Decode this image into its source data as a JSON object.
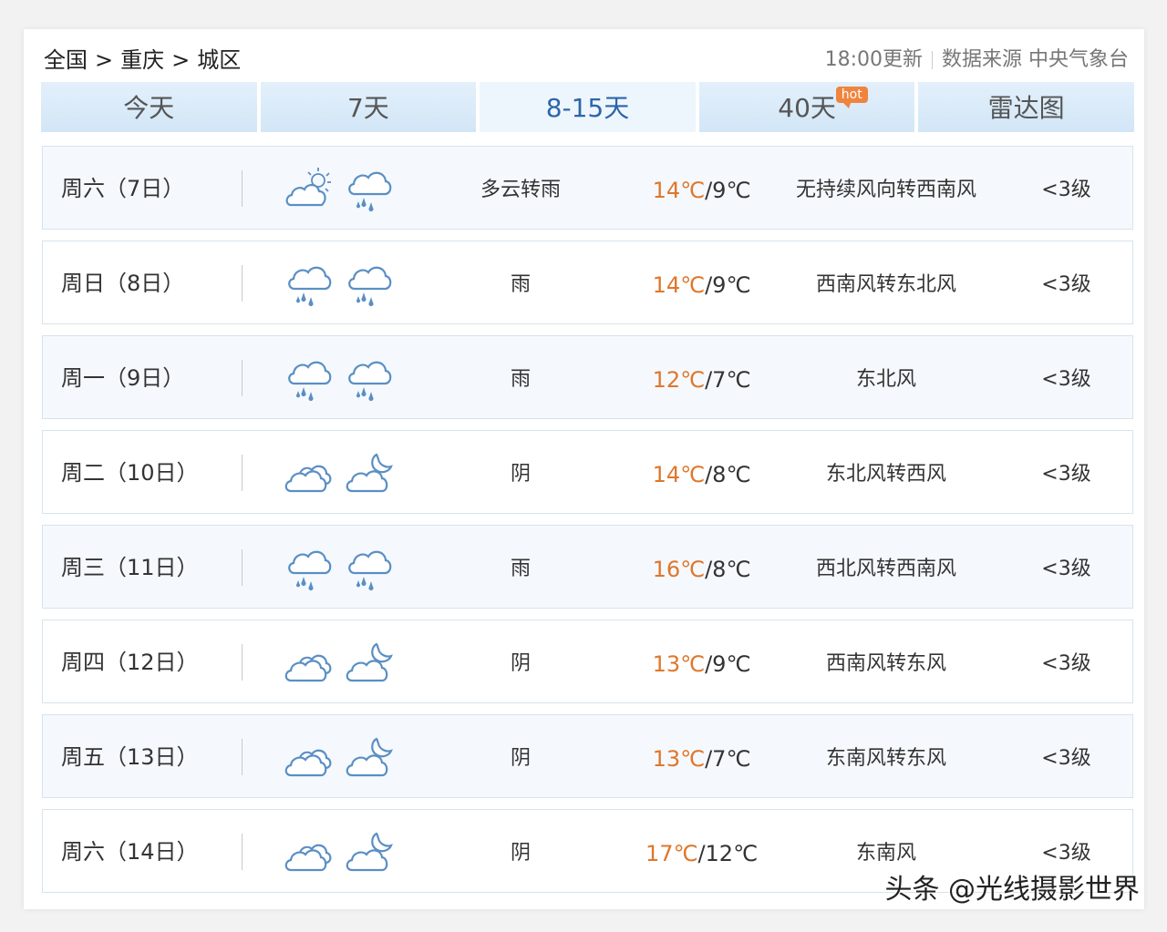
{
  "breadcrumb": {
    "country": "全国",
    "province": "重庆",
    "district": "城区",
    "separator": ">"
  },
  "meta": {
    "update_time": "18:00更新",
    "source": "数据来源 中央气象台"
  },
  "tabs": [
    {
      "label": "今天",
      "active": false
    },
    {
      "label": "7天",
      "active": false
    },
    {
      "label": "8-15天",
      "active": true
    },
    {
      "label": "40天",
      "active": false,
      "badge": "hot"
    },
    {
      "label": "雷达图",
      "active": false
    }
  ],
  "forecast": [
    {
      "day": "周六（7日）",
      "icon_day": "partly-cloudy-icon",
      "icon_night": "rain-icon",
      "desc": "多云转雨",
      "high": "14℃",
      "low": "/9℃",
      "wind": "无持续风向转西南风",
      "level": "<3级"
    },
    {
      "day": "周日（8日）",
      "icon_day": "rain-icon",
      "icon_night": "rain-icon",
      "desc": "雨",
      "high": "14℃",
      "low": "/9℃",
      "wind": "西南风转东北风",
      "level": "<3级"
    },
    {
      "day": "周一（9日）",
      "icon_day": "rain-icon",
      "icon_night": "rain-icon",
      "desc": "雨",
      "high": "12℃",
      "low": "/7℃",
      "wind": "东北风",
      "level": "<3级"
    },
    {
      "day": "周二（10日）",
      "icon_day": "overcast-icon",
      "icon_night": "cloudy-night-icon",
      "desc": "阴",
      "high": "14℃",
      "low": "/8℃",
      "wind": "东北风转西风",
      "level": "<3级"
    },
    {
      "day": "周三（11日）",
      "icon_day": "rain-icon",
      "icon_night": "rain-icon",
      "desc": "雨",
      "high": "16℃",
      "low": "/8℃",
      "wind": "西北风转西南风",
      "level": "<3级"
    },
    {
      "day": "周四（12日）",
      "icon_day": "overcast-icon",
      "icon_night": "cloudy-night-icon",
      "desc": "阴",
      "high": "13℃",
      "low": "/9℃",
      "wind": "西南风转东风",
      "level": "<3级"
    },
    {
      "day": "周五（13日）",
      "icon_day": "overcast-icon",
      "icon_night": "cloudy-night-icon",
      "desc": "阴",
      "high": "13℃",
      "low": "/7℃",
      "wind": "东南风转东风",
      "level": "<3级"
    },
    {
      "day": "周六（14日）",
      "icon_day": "overcast-icon",
      "icon_night": "cloudy-night-icon",
      "desc": "阴",
      "high": "17℃",
      "low": "/12℃",
      "wind": "东南风",
      "level": "<3级"
    }
  ],
  "watermark": "头条 @光线摄影世界",
  "colors": {
    "accent": "#2c66a8",
    "high_temp": "#e0762a",
    "icon": "#5a8fc4",
    "tab_bg": "#d2e6f7"
  }
}
